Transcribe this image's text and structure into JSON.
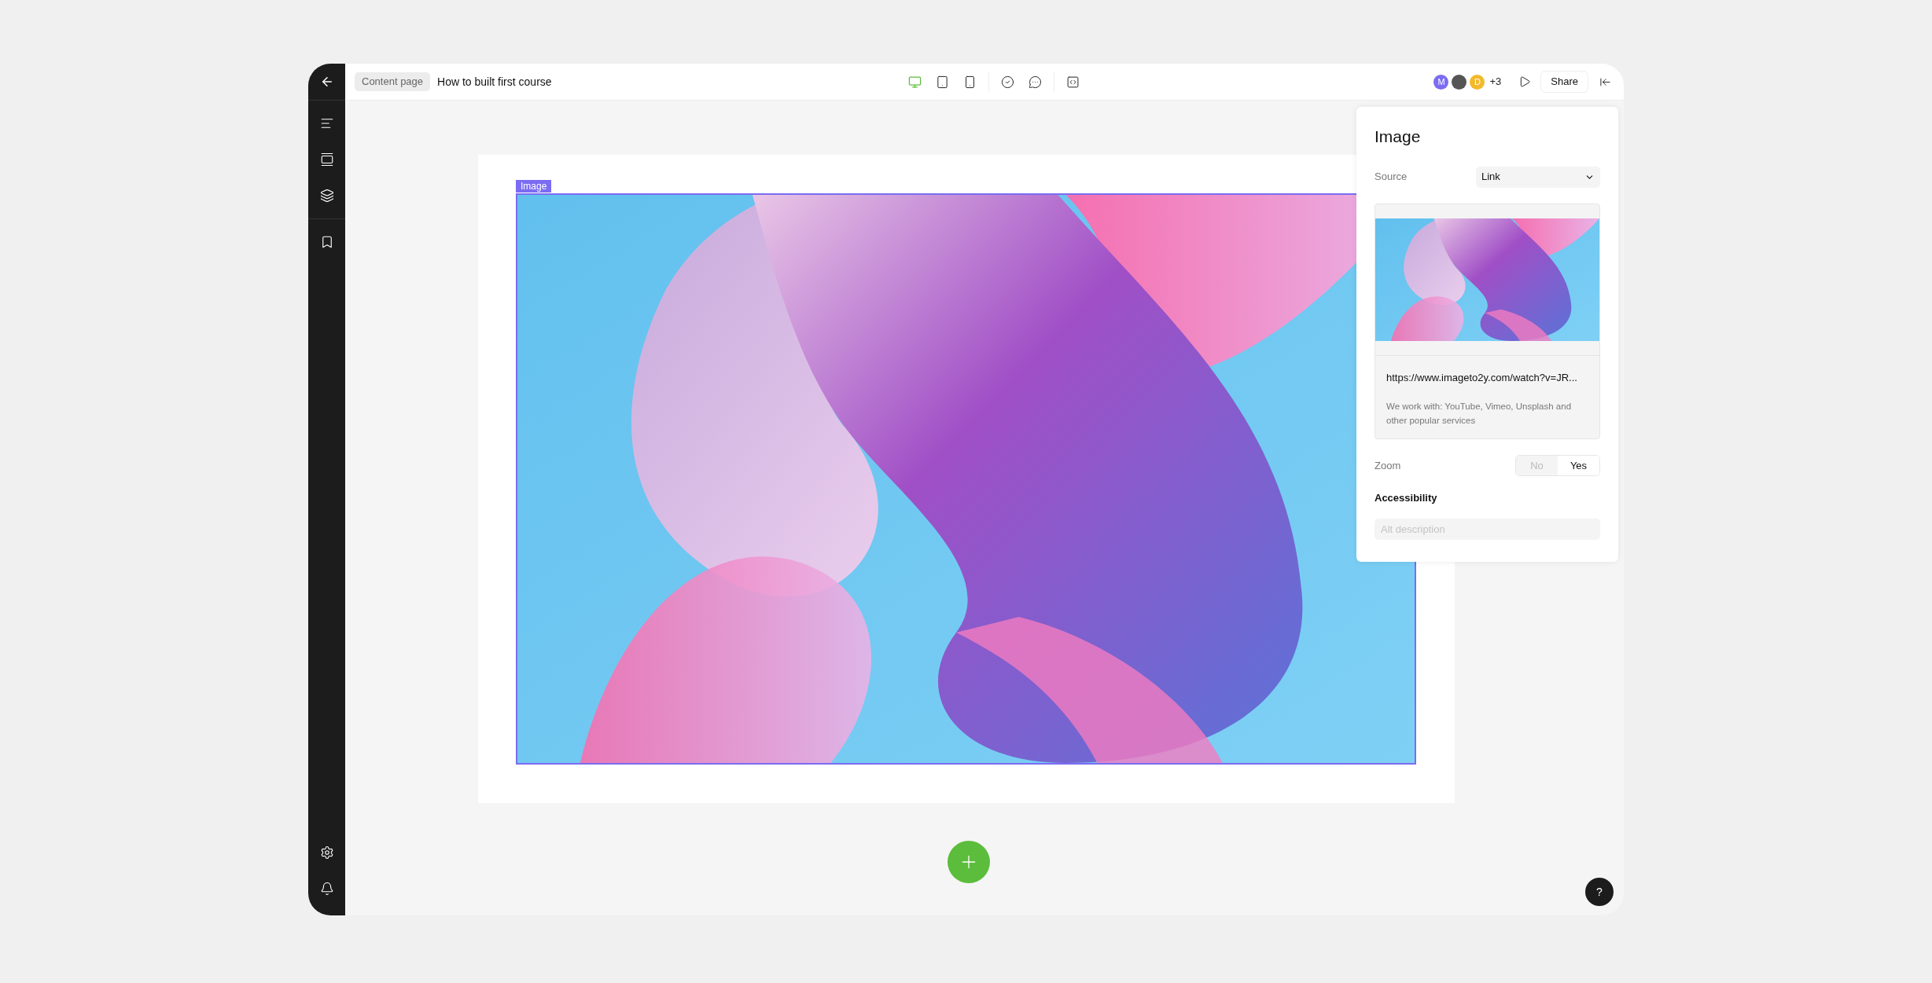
{
  "topbar": {
    "breadcrumb": "Content page",
    "title": "How to built first course",
    "devices": [
      {
        "kind": "desktop",
        "selected": true
      },
      {
        "kind": "tablet",
        "selected": false
      },
      {
        "kind": "phone",
        "selected": false
      }
    ],
    "avatars": [
      {
        "kind": "letter",
        "initial": "M",
        "color": "#7b6cf2"
      },
      {
        "kind": "photo"
      },
      {
        "kind": "letter",
        "initial": "D",
        "color": "#f2b92b"
      }
    ],
    "more_count": "+3",
    "share": "Share"
  },
  "canvas": {
    "block_label": "Image"
  },
  "panel": {
    "title": "Image",
    "source_label": "Source",
    "source_value": "Link",
    "url": "https://www.imageto2y.com/watch?v=JR...",
    "helper": "We work with: YouTube, Vimeo, Unsplash and other popular services",
    "zoom_label": "Zoom",
    "zoom_options": [
      {
        "label": "No",
        "selected": false
      },
      {
        "label": "Yes",
        "selected": true
      }
    ],
    "accessibility": "Accessibility",
    "alt_placeholder": "Alt description"
  },
  "help": "?"
}
